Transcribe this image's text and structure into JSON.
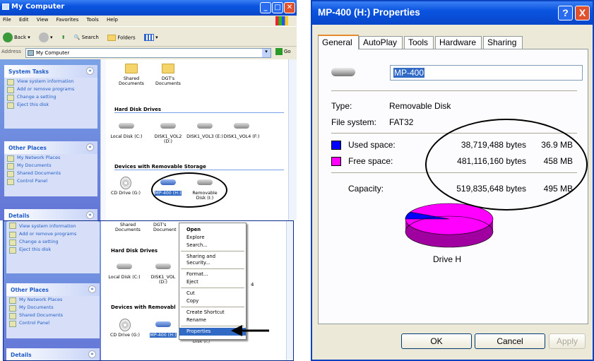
{
  "explorer": {
    "title": "My Computer",
    "menu": [
      "File",
      "Edit",
      "View",
      "Favorites",
      "Tools",
      "Help"
    ],
    "toolbar": {
      "back": "Back",
      "search": "Search",
      "folders": "Folders"
    },
    "address_label": "Address",
    "address_value": "My Computer",
    "go": "Go",
    "system_tasks": {
      "title": "System Tasks",
      "items": [
        "View system information",
        "Add or remove programs",
        "Change a setting",
        "Eject this disk"
      ]
    },
    "other_places": {
      "title": "Other Places",
      "items": [
        "My Network Places",
        "My Documents",
        "Shared Documents",
        "Control Panel"
      ]
    },
    "details_title": "Details",
    "shared_folders": [
      "Shared Documents",
      "DGT's Documents"
    ],
    "hard_disk_section": "Hard Disk Drives",
    "hard_disks": [
      "Local Disk (C:)",
      "DISK1_VOL2 (D:)",
      "DISK1_VOL3 (E:)",
      "DISK1_VOL4 (F:)"
    ],
    "removable_section": "Devices with Removable Storage",
    "removable": [
      "CD Drive (G:)",
      "MP-400 (H:)",
      "Removable Disk (I:)"
    ]
  },
  "explorer_lower": {
    "system_tasks_items": [
      "View system information",
      "Add or remove programs",
      "Change a setting",
      "Eject this disk"
    ],
    "other_places_title": "Other Places",
    "other_places_items": [
      "My Network Places",
      "My Documents",
      "Shared Documents",
      "Control Panel"
    ],
    "details_title": "Details",
    "shared_folders": [
      "Shared Documents",
      "DGT's Document"
    ],
    "hard_disk_section": "Hard Disk Drives",
    "hard_disks": [
      "Local Disk (C:)",
      "DISK1_VOL (D:)"
    ],
    "removable_section": "Devices with Removabl",
    "removable": [
      "CD Drive (G:)",
      "MP-400 (H:)",
      "Removable Disk (I:)"
    ],
    "context_menu": [
      "Open",
      "Explore",
      "Search...",
      "Sharing and Security...",
      "Format...",
      "Eject",
      "Cut",
      "Copy",
      "Create Shortcut",
      "Rename",
      "Properties"
    ]
  },
  "properties": {
    "title": "MP-400 (H:) Properties",
    "help_btn": "?",
    "close_btn": "X",
    "tabs": [
      "General",
      "AutoPlay",
      "Tools",
      "Hardware",
      "Sharing"
    ],
    "name_value": "MP-400",
    "type_label": "Type:",
    "type_value": "Removable Disk",
    "fs_label": "File system:",
    "fs_value": "FAT32",
    "used_label": "Used space:",
    "used_bytes": "38,719,488 bytes",
    "used_mb": "36.9 MB",
    "free_label": "Free space:",
    "free_bytes": "481,116,160 bytes",
    "free_mb": "458 MB",
    "cap_label": "Capacity:",
    "cap_bytes": "519,835,648 bytes",
    "cap_mb": "495 MB",
    "drive_label": "Drive H",
    "used_color": "#0000ff",
    "free_color": "#ff00ff",
    "used_fraction": 0.0745,
    "ok": "OK",
    "cancel": "Cancel",
    "apply": "Apply"
  }
}
